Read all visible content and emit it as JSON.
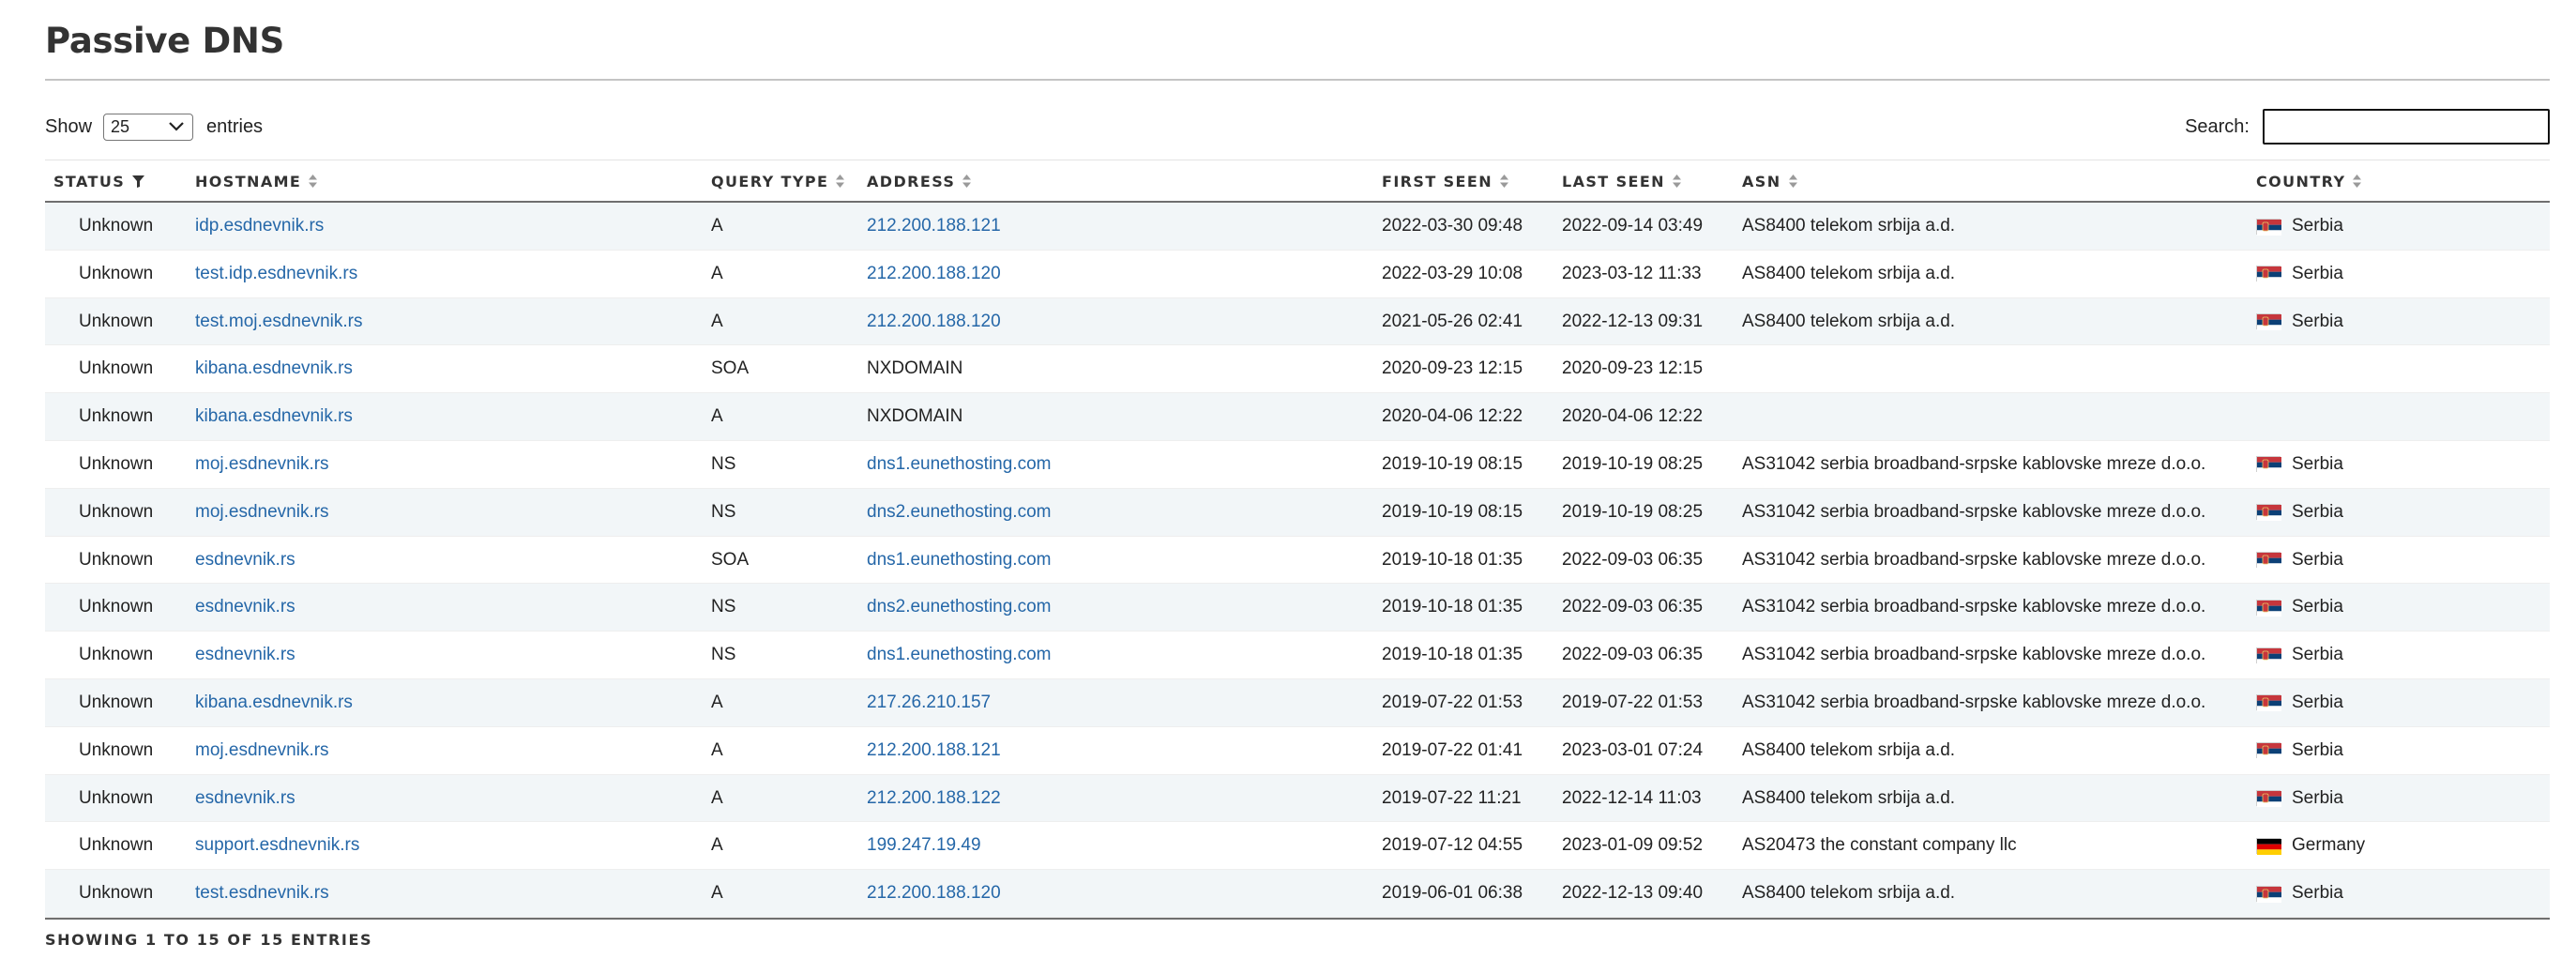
{
  "title": "Passive DNS",
  "length_control": {
    "show_label": "Show",
    "selected": "25",
    "entries_label": "entries"
  },
  "search": {
    "label": "Search:",
    "value": ""
  },
  "columns": [
    {
      "key": "status",
      "label": "STATUS",
      "icon": "filter-icon"
    },
    {
      "key": "hostname",
      "label": "HOSTNAME",
      "icon": "sort-icon"
    },
    {
      "key": "query_type",
      "label": "QUERY TYPE",
      "icon": "sort-icon"
    },
    {
      "key": "address",
      "label": "ADDRESS",
      "icon": "sort-icon"
    },
    {
      "key": "first_seen",
      "label": "FIRST SEEN",
      "icon": "sort-icon"
    },
    {
      "key": "last_seen",
      "label": "LAST SEEN",
      "icon": "sort-icon"
    },
    {
      "key": "asn",
      "label": "ASN",
      "icon": "sort-icon"
    },
    {
      "key": "country",
      "label": "COUNTRY",
      "icon": "sort-icon"
    }
  ],
  "rows": [
    {
      "status": "Unknown",
      "hostname": "idp.esdnevnik.rs",
      "query_type": "A",
      "address": "212.200.188.121",
      "address_link": true,
      "first_seen": "2022-03-30 09:48",
      "last_seen": "2022-09-14 03:49",
      "asn": "AS8400 telekom srbija a.d.",
      "country": "Serbia",
      "flag": "serbia-flag-icon"
    },
    {
      "status": "Unknown",
      "hostname": "test.idp.esdnevnik.rs",
      "query_type": "A",
      "address": "212.200.188.120",
      "address_link": true,
      "first_seen": "2022-03-29 10:08",
      "last_seen": "2023-03-12 11:33",
      "asn": "AS8400 telekom srbija a.d.",
      "country": "Serbia",
      "flag": "serbia-flag-icon"
    },
    {
      "status": "Unknown",
      "hostname": "test.moj.esdnevnik.rs",
      "query_type": "A",
      "address": "212.200.188.120",
      "address_link": true,
      "first_seen": "2021-05-26 02:41",
      "last_seen": "2022-12-13 09:31",
      "asn": "AS8400 telekom srbija a.d.",
      "country": "Serbia",
      "flag": "serbia-flag-icon"
    },
    {
      "status": "Unknown",
      "hostname": "kibana.esdnevnik.rs",
      "query_type": "SOA",
      "address": "NXDOMAIN",
      "address_link": false,
      "first_seen": "2020-09-23 12:15",
      "last_seen": "2020-09-23 12:15",
      "asn": "",
      "country": "",
      "flag": ""
    },
    {
      "status": "Unknown",
      "hostname": "kibana.esdnevnik.rs",
      "query_type": "A",
      "address": "NXDOMAIN",
      "address_link": false,
      "first_seen": "2020-04-06 12:22",
      "last_seen": "2020-04-06 12:22",
      "asn": "",
      "country": "",
      "flag": ""
    },
    {
      "status": "Unknown",
      "hostname": "moj.esdnevnik.rs",
      "query_type": "NS",
      "address": "dns1.eunethosting.com",
      "address_link": true,
      "first_seen": "2019-10-19 08:15",
      "last_seen": "2019-10-19 08:25",
      "asn": "AS31042 serbia broadband-srpske kablovske mreze d.o.o.",
      "country": "Serbia",
      "flag": "serbia-flag-icon"
    },
    {
      "status": "Unknown",
      "hostname": "moj.esdnevnik.rs",
      "query_type": "NS",
      "address": "dns2.eunethosting.com",
      "address_link": true,
      "first_seen": "2019-10-19 08:15",
      "last_seen": "2019-10-19 08:25",
      "asn": "AS31042 serbia broadband-srpske kablovske mreze d.o.o.",
      "country": "Serbia",
      "flag": "serbia-flag-icon"
    },
    {
      "status": "Unknown",
      "hostname": "esdnevnik.rs",
      "query_type": "SOA",
      "address": "dns1.eunethosting.com",
      "address_link": true,
      "first_seen": "2019-10-18 01:35",
      "last_seen": "2022-09-03 06:35",
      "asn": "AS31042 serbia broadband-srpske kablovske mreze d.o.o.",
      "country": "Serbia",
      "flag": "serbia-flag-icon"
    },
    {
      "status": "Unknown",
      "hostname": "esdnevnik.rs",
      "query_type": "NS",
      "address": "dns2.eunethosting.com",
      "address_link": true,
      "first_seen": "2019-10-18 01:35",
      "last_seen": "2022-09-03 06:35",
      "asn": "AS31042 serbia broadband-srpske kablovske mreze d.o.o.",
      "country": "Serbia",
      "flag": "serbia-flag-icon"
    },
    {
      "status": "Unknown",
      "hostname": "esdnevnik.rs",
      "query_type": "NS",
      "address": "dns1.eunethosting.com",
      "address_link": true,
      "first_seen": "2019-10-18 01:35",
      "last_seen": "2022-09-03 06:35",
      "asn": "AS31042 serbia broadband-srpske kablovske mreze d.o.o.",
      "country": "Serbia",
      "flag": "serbia-flag-icon"
    },
    {
      "status": "Unknown",
      "hostname": "kibana.esdnevnik.rs",
      "query_type": "A",
      "address": "217.26.210.157",
      "address_link": true,
      "first_seen": "2019-07-22 01:53",
      "last_seen": "2019-07-22 01:53",
      "asn": "AS31042 serbia broadband-srpske kablovske mreze d.o.o.",
      "country": "Serbia",
      "flag": "serbia-flag-icon"
    },
    {
      "status": "Unknown",
      "hostname": "moj.esdnevnik.rs",
      "query_type": "A",
      "address": "212.200.188.121",
      "address_link": true,
      "first_seen": "2019-07-22 01:41",
      "last_seen": "2023-03-01 07:24",
      "asn": "AS8400 telekom srbija a.d.",
      "country": "Serbia",
      "flag": "serbia-flag-icon"
    },
    {
      "status": "Unknown",
      "hostname": "esdnevnik.rs",
      "query_type": "A",
      "address": "212.200.188.122",
      "address_link": true,
      "first_seen": "2019-07-22 11:21",
      "last_seen": "2022-12-14 11:03",
      "asn": "AS8400 telekom srbija a.d.",
      "country": "Serbia",
      "flag": "serbia-flag-icon"
    },
    {
      "status": "Unknown",
      "hostname": "support.esdnevnik.rs",
      "query_type": "A",
      "address": "199.247.19.49",
      "address_link": true,
      "first_seen": "2019-07-12 04:55",
      "last_seen": "2023-01-09 09:52",
      "asn": "AS20473 the constant company llc",
      "country": "Germany",
      "flag": "germany-flag-icon"
    },
    {
      "status": "Unknown",
      "hostname": "test.esdnevnik.rs",
      "query_type": "A",
      "address": "212.200.188.120",
      "address_link": true,
      "first_seen": "2019-06-01 06:38",
      "last_seen": "2022-12-13 09:40",
      "asn": "AS8400 telekom srbija a.d.",
      "country": "Serbia",
      "flag": "serbia-flag-icon"
    }
  ],
  "info_text": "SHOWING 1 TO 15 OF 15 ENTRIES",
  "colors": {
    "link": "#2567a8",
    "stripe": "#f2f6f8",
    "header_rule": "#6f6f6f"
  }
}
